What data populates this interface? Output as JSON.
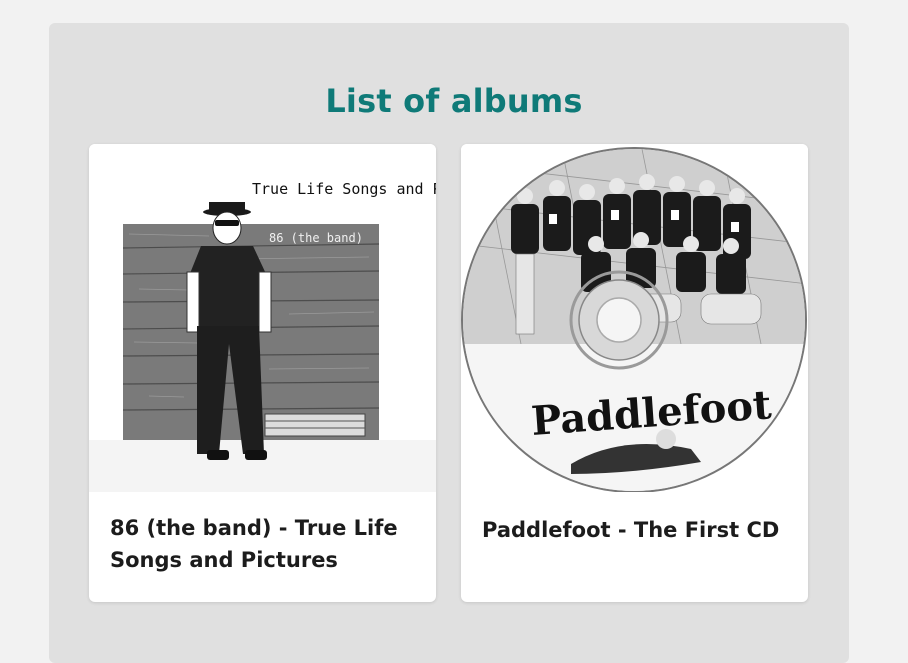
{
  "page": {
    "title": "List of albums",
    "accent_color": "#0f7a78"
  },
  "albums": [
    {
      "label": "86 (the band) - True Life Songs and Pictures",
      "cover_text": "True Life Songs and Pictures",
      "cover_subtext": "86 (the band)"
    },
    {
      "label": "Paddlefoot - The First CD",
      "cover_text": "Paddlefoot"
    }
  ]
}
